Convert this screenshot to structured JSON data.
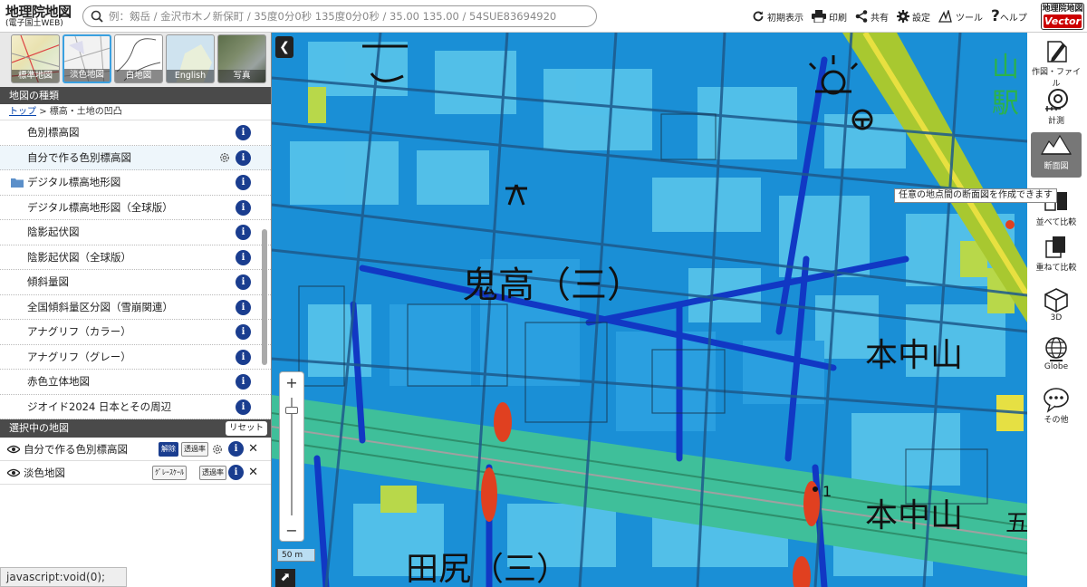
{
  "header": {
    "logo_line1": "地理院地図",
    "logo_line2": "(電子国土WEB)",
    "search_placeholder": "例：剱岳 / 金沢市木ノ新保町 / 35度0分0秒 135度0分0秒 / 35.00 135.00 / 54SUE83694920",
    "buttons": [
      {
        "label": "初期表示",
        "icon": "reset-view-icon"
      },
      {
        "label": "印刷",
        "icon": "printer-icon"
      },
      {
        "label": "共有",
        "icon": "share-icon"
      },
      {
        "label": "設定",
        "icon": "gear-icon"
      },
      {
        "label": "ツール",
        "icon": "tool-icon"
      },
      {
        "label": "ヘルプ",
        "icon": "help-icon"
      }
    ],
    "vector_logo_line1": "地理院地図",
    "vector_logo_line2": "Vector"
  },
  "left_panel": {
    "base_maps": [
      {
        "label": "標準地図",
        "selected": false
      },
      {
        "label": "淡色地図",
        "selected": true
      },
      {
        "label": "白地図",
        "selected": false
      },
      {
        "label": "English",
        "selected": false
      },
      {
        "label": "写真",
        "selected": false
      }
    ],
    "section_title": "地図の種類",
    "breadcrumb_top": "トップ",
    "breadcrumb_rest": "> 標高・土地の凹凸",
    "layers": [
      {
        "label": "色別標高図",
        "type": "item"
      },
      {
        "label": "自分で作る色別標高図",
        "type": "item-gear",
        "selected": true
      },
      {
        "label": "デジタル標高地形図",
        "type": "folder"
      },
      {
        "label": "デジタル標高地形図（全球版）",
        "type": "item"
      },
      {
        "label": "陰影起伏図",
        "type": "item"
      },
      {
        "label": "陰影起伏図（全球版）",
        "type": "item"
      },
      {
        "label": "傾斜量図",
        "type": "item"
      },
      {
        "label": "全国傾斜量区分図（雪崩関連）",
        "type": "item"
      },
      {
        "label": "アナグリフ（カラー）",
        "type": "item"
      },
      {
        "label": "アナグリフ（グレー）",
        "type": "item"
      },
      {
        "label": "赤色立体地図",
        "type": "item"
      },
      {
        "label": "ジオイド2024 日本とその周辺",
        "type": "item"
      }
    ],
    "info_label": "i",
    "selected_title": "選択中の地図",
    "reset_label": "リセット",
    "selected_layers": [
      {
        "label": "自分で作る色別標高図",
        "btn1": "解除",
        "btn2": "透過率"
      },
      {
        "label": "淡色地図",
        "btn1": "ｸﾞﾚｰｽｹｰﾙ",
        "btn2": "透過率"
      }
    ],
    "close_label": "✕",
    "status_text": "javascript:void(0);"
  },
  "map": {
    "labels": [
      "鬼高（三）",
      "本中山",
      "本中山",
      "田尻（三）",
      "山",
      "駅",
      "五"
    ],
    "scale_text": "50 m",
    "collapse_glyph": "❮",
    "zoom_in": "+",
    "zoom_out": "−",
    "marker_number": "1"
  },
  "toolbar": {
    "tools": [
      {
        "label": "作図・ファイル",
        "icon": "pencil-icon"
      },
      {
        "label": "計測",
        "icon": "measure-icon"
      },
      {
        "label": "断面図",
        "icon": "profile-icon",
        "active": true
      },
      {
        "label": "並べて比較",
        "icon": "side-by-side-icon"
      },
      {
        "label": "重ねて比較",
        "icon": "overlay-compare-icon"
      },
      {
        "label": "3D",
        "icon": "cube-icon"
      },
      {
        "label": "Globe",
        "icon": "globe-icon"
      },
      {
        "label": "その他",
        "icon": "more-icon"
      }
    ],
    "tooltip": "任意の地点間の断面図を作成できます"
  }
}
